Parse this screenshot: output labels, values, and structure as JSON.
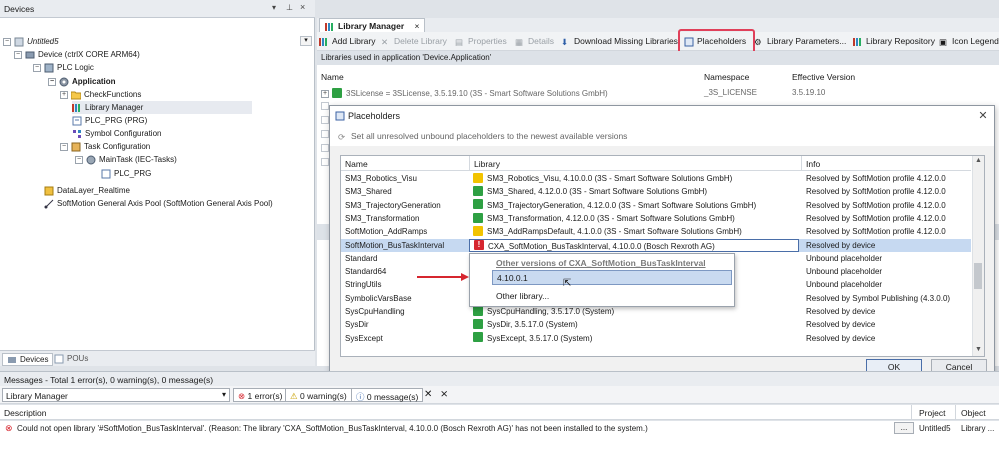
{
  "devices_panel": {
    "title": "Devices",
    "tree": [
      {
        "label": "Untitled5",
        "italic": true
      },
      {
        "label": "Device (ctrlX CORE ARM64)"
      },
      {
        "label": "PLC Logic"
      },
      {
        "label": "Application",
        "bold": true
      },
      {
        "label": "CheckFunctions"
      },
      {
        "label": "Library Manager"
      },
      {
        "label": "PLC_PRG (PRG)"
      },
      {
        "label": "Symbol Configuration"
      },
      {
        "label": "Task Configuration"
      },
      {
        "label": "MainTask (IEC-Tasks)"
      },
      {
        "label": "PLC_PRG"
      },
      {
        "label": "DataLayer_Realtime"
      },
      {
        "label": "SoftMotion General Axis Pool (SoftMotion General Axis Pool)"
      }
    ],
    "tabs": [
      "Devices",
      "POUs"
    ]
  },
  "library_manager": {
    "tab_label": "Library Manager",
    "toolbar": {
      "add_library": "Add Library",
      "delete_library": "Delete Library",
      "properties": "Properties",
      "details": "Details",
      "download_missing": "Download Missing Libraries",
      "placeholders": "Placeholders",
      "library_parameters": "Library Parameters...",
      "library_repository": "Library Repository",
      "icon_legend": "Icon Legend"
    },
    "subtitle": "Libraries used in application 'Device.Application'",
    "columns": {
      "name": "Name",
      "namespace": "Namespace",
      "effective_version": "Effective Version"
    },
    "rows": [
      {
        "name": "3SLicense = 3SLicense, 3.5.19.10 (3S - Smart Software Solutions GmbH)",
        "namespace": "_3S_LICENSE",
        "version": "3.5.19.10"
      }
    ]
  },
  "placeholders_dialog": {
    "title": "Placeholders",
    "set_all": "Set all unresolved unbound placeholders to the newest available versions",
    "columns": {
      "name": "Name",
      "library": "Library",
      "info": "Info"
    },
    "rows": [
      {
        "name": "SM3_Robotics_Visu",
        "library": "SM3_Robotics_Visu, 4.10.0.0 (3S - Smart Software Solutions GmbH)",
        "info": "Resolved by SoftMotion profile 4.12.0.0",
        "icon": "yellow"
      },
      {
        "name": "SM3_Shared",
        "library": "SM3_Shared, 4.12.0.0 (3S - Smart Software Solutions GmbH)",
        "info": "Resolved by SoftMotion profile 4.12.0.0",
        "icon": "green"
      },
      {
        "name": "SM3_TrajectoryGeneration",
        "library": "SM3_TrajectoryGeneration, 4.12.0.0 (3S - Smart Software Solutions GmbH)",
        "info": "Resolved by SoftMotion profile 4.12.0.0",
        "icon": "green"
      },
      {
        "name": "SM3_Transformation",
        "library": "SM3_Transformation, 4.12.0.0 (3S - Smart Software Solutions GmbH)",
        "info": "Resolved by SoftMotion profile 4.12.0.0",
        "icon": "green"
      },
      {
        "name": "SoftMotion_AddRamps",
        "library": "SM3_AddRampsDefault, 4.1.0.0 (3S - Smart Software Solutions GmbH)",
        "info": "Resolved by SoftMotion profile 4.12.0.0",
        "icon": "yellow"
      },
      {
        "name": "SoftMotion_BusTaskInterval",
        "library": "CXA_SoftMotion_BusTaskInterval, 4.10.0.0 (Bosch Rexroth AG)",
        "info": "Resolved by device",
        "icon": "red",
        "selected": true
      },
      {
        "name": "Standard",
        "library": "",
        "info": "Unbound placeholder",
        "icon": ""
      },
      {
        "name": "Standard64",
        "library": "",
        "info": "Unbound placeholder",
        "icon": ""
      },
      {
        "name": "StringUtils",
        "library": "",
        "info": "Unbound placeholder",
        "icon": ""
      },
      {
        "name": "SymbolicVarsBase",
        "library": "",
        "info": "Resolved by Symbol Publishing (4.3.0.0)",
        "icon": ""
      },
      {
        "name": "SysCpuHandling",
        "library": "SysCpuHandling, 3.5.17.0 (System)",
        "info": "Resolved by device",
        "icon": "green"
      },
      {
        "name": "SysDir",
        "library": "SysDir, 3.5.17.0 (System)",
        "info": "Resolved by device",
        "icon": "green"
      },
      {
        "name": "SysExcept",
        "library": "SysExcept, 3.5.17.0 (System)",
        "info": "Resolved by device",
        "icon": "green"
      }
    ],
    "popup": {
      "heading": "Other versions of CXA_SoftMotion_BusTaskInterval",
      "version_item": "4.10.0.1",
      "other_library": "Other library..."
    },
    "ok_label": "OK",
    "cancel_label": "Cancel"
  },
  "messages": {
    "header": "Messages - Total 1 error(s), 0 warning(s), 0 message(s)",
    "source": "Library Manager",
    "errors_btn": "1 error(s)",
    "warnings_btn": "0 warning(s)",
    "messages_btn": "0 message(s)",
    "columns": {
      "description": "Description",
      "project": "Project",
      "object": "Object"
    },
    "row": {
      "description": "Could not open library '#SoftMotion_BusTaskInterval'. (Reason: The library 'CXA_SoftMotion_BusTaskInterval, 4.10.0.0 (Bosch Rexroth AG)' has not been installed to the system.)",
      "ellipsis": "...",
      "project": "Untitled5",
      "object": "Library ..."
    }
  },
  "colors": {
    "highlight_border": "#e0405a",
    "selection": "#c6d9f1",
    "error": "#d6262f",
    "ok_green": "#2ea043",
    "warn_yellow": "#f2c300"
  }
}
